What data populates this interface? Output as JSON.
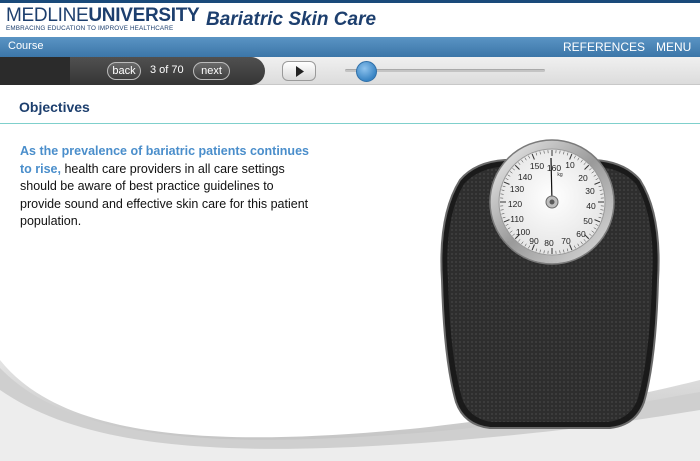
{
  "header": {
    "logo_light": "MEDLINE",
    "logo_bold": "UNIVERSITY",
    "logo_tagline": "EMBRACING EDUCATION TO IMPROVE HEALTHCARE",
    "course_title": "Bariatric Skin Care"
  },
  "navbar": {
    "course_label": "Course",
    "references_label": "REFERENCES",
    "menu_label": "MENU"
  },
  "controls": {
    "back_label": "back",
    "next_label": "next",
    "page_indicator": "3 of 70",
    "play_icon": "play-icon",
    "slider_position": 0.05
  },
  "content": {
    "heading": "Objectives",
    "highlight_text": "As the prevalence of bariatric patients continues to rise,",
    "body_text": " health care providers in all care settings should be aware of best practice guidelines to provide sound and effective skin care for this patient population."
  },
  "scale_dial": {
    "numbers": [
      "150",
      "160",
      "10",
      "140",
      "20",
      "130",
      "30",
      "120",
      "40",
      "110",
      "50",
      "100",
      "60",
      "90",
      "80",
      "70"
    ],
    "unit": "kg"
  },
  "colors": {
    "brand_navy": "#1d3f6e",
    "nav_blue": "#4a86ba",
    "highlight_blue": "#4a8ecb",
    "divider_teal": "#7fd0cc"
  }
}
